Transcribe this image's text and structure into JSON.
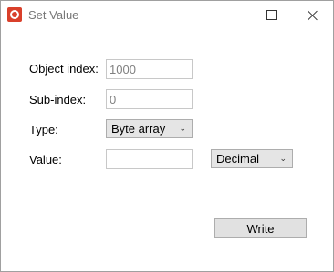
{
  "window": {
    "title": "Set Value"
  },
  "form": {
    "object_index_label": "Object index:",
    "object_index_value": "1000",
    "sub_index_label": "Sub-index:",
    "sub_index_value": "0",
    "type_label": "Type:",
    "type_selected": "Byte array",
    "value_label": "Value:",
    "value_value": "",
    "format_selected": "Decimal",
    "write_label": "Write"
  }
}
